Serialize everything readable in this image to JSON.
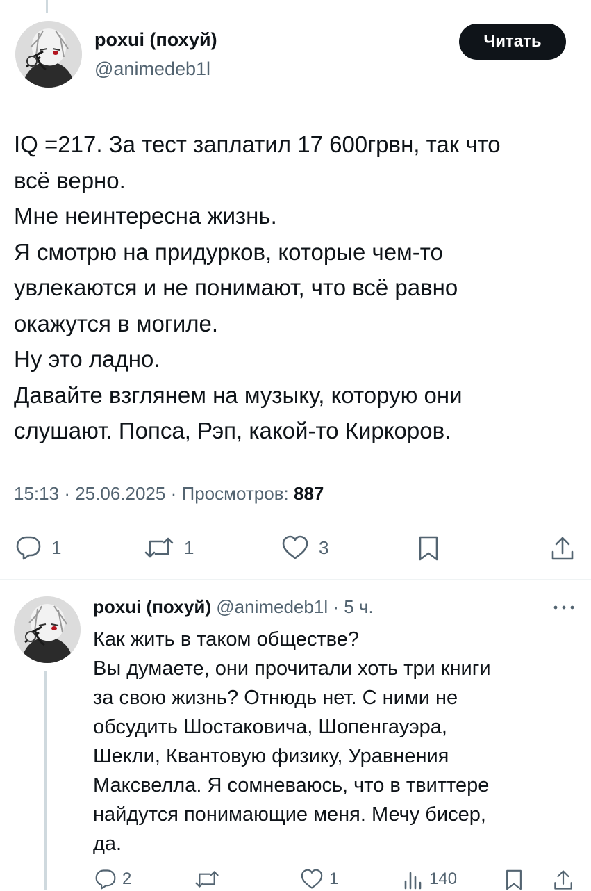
{
  "main_tweet": {
    "author_name": "poxui (похуй)",
    "author_handle": "@animedeb1l",
    "follow_label": "Читать",
    "text_lines": [
      "IQ =217. За тест заплатил 17 600грвн, так что",
      "всё верно.",
      "Мне неинтересна жизнь.",
      "Я смотрю на придурков, которые чем-то",
      "увлекаются и не понимают, что всё равно",
      "окажутся в могиле.",
      "Ну это ладно.",
      "Давайте взглянем на музыку, которую они",
      "слушают. Попса, Рэп, какой-то Киркоров."
    ],
    "time": "15:13",
    "date": "25.06.2025",
    "views_label": "Просмотров:",
    "views_count": "887",
    "separator": "·",
    "actions": {
      "replies": "1",
      "retweets": "1",
      "likes": "3"
    },
    "icons": [
      "reply-icon",
      "retweet-icon",
      "like-icon",
      "bookmark-icon",
      "share-icon"
    ]
  },
  "reply_tweet": {
    "author_name": "poxui (похуй)",
    "author_handle": "@animedeb1l",
    "time_ago": "5 ч.",
    "separator": "·",
    "text_lines": [
      "Как жить в таком обществе?",
      "Вы думаете, они прочитали хоть три книги",
      "за свою жизнь? Отнюдь нет. С ними не",
      "обсудить Шостаковича, Шопенгауэра,",
      "Шекли, Квантовую физику, Уравнения",
      "Максвелла. Я сомневаюсь, что в твиттере",
      "найдутся понимающие меня. Мечу бисер,",
      "да."
    ],
    "actions": {
      "replies": "2",
      "retweets": "",
      "likes": "1",
      "views": "140"
    },
    "icons": [
      "reply-icon",
      "retweet-icon",
      "like-icon",
      "views-icon",
      "bookmark-icon",
      "share-icon",
      "more-icon"
    ]
  },
  "colors": {
    "text": "#0f1419",
    "secondary": "#536471",
    "button_bg": "#0f1419",
    "thread_line": "#cfd9de"
  }
}
